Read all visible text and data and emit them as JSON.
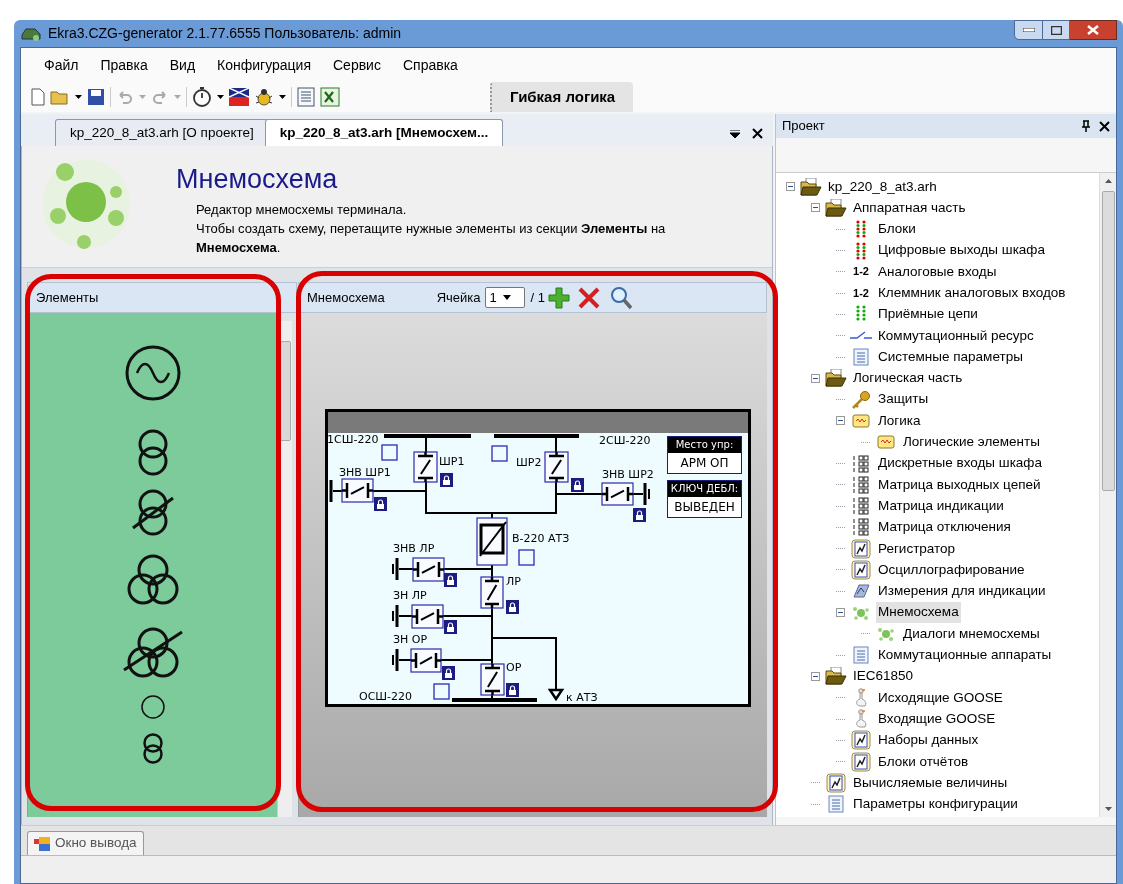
{
  "window": {
    "title": "Ekra3.CZG-generator 2.1.77.6555 Пользователь: admin"
  },
  "menu": [
    "Файл",
    "Правка",
    "Вид",
    "Конфигурация",
    "Сервис",
    "Справка"
  ],
  "toolbar": {
    "flex_button": "Гибкая логика"
  },
  "document_tabs": [
    {
      "label": "kp_220_8_at3.arh [О проекте]",
      "selected": false
    },
    {
      "label": "kp_220_8_at3.arh [Мнемосхем...",
      "selected": true
    }
  ],
  "header": {
    "title": "Мнемосхема",
    "description": [
      "Редактор мнемосхемы терминала.",
      "Чтобы создать схему, перетащите нужные элементы из секции **Элементы** на **Мнемосхема**."
    ]
  },
  "elements_panel": {
    "title": "Элементы"
  },
  "mnemo_panel": {
    "title": "Мнемосхема",
    "cell_label": "Ячейка",
    "cell_value": "1",
    "cell_total": "/ 1"
  },
  "diagram": {
    "labels": [
      "1СШ-220",
      "2СШ-220",
      "ШР1",
      "ШР2",
      "ЗНВ ШР1",
      "ЗНВ ШР2",
      "В-220 АТЗ",
      "ЗНВ ЛР",
      "ЛР",
      "ЗН ЛР",
      "ЗН ОР",
      "ОР",
      "ОСШ-220",
      "к АТЗ"
    ],
    "panels": [
      {
        "title": "Место упр:",
        "value": "АРМ ОП"
      },
      {
        "title": "КЛЮЧ ДЕБЛ:",
        "value": "ВЫВЕДЕН"
      }
    ]
  },
  "project_panel": {
    "title": "Проект",
    "tree": [
      {
        "label": "kp_220_8_at3.arh",
        "kind": "folder",
        "expanded": true,
        "selected": false,
        "children": [
          {
            "label": "Аппаратная часть",
            "kind": "folder",
            "expanded": true,
            "selected": false,
            "children": [
              {
                "label": "Блоки",
                "kind": "leds",
                "selected": false
              },
              {
                "label": "Цифровые выходы шкафа",
                "kind": "leds",
                "selected": false
              },
              {
                "label": "Аналоговые входы",
                "kind": "numbers",
                "icon_label": "1-2",
                "selected": false
              },
              {
                "label": "Клеммник аналоговых входов",
                "kind": "numbers",
                "icon_label": "1-2",
                "selected": false
              },
              {
                "label": "Приёмные цепи",
                "kind": "green_leds",
                "selected": false
              },
              {
                "label": "Коммутационный ресурс",
                "kind": "switch",
                "selected": false
              },
              {
                "label": "Системные параметры",
                "kind": "doc",
                "selected": false
              }
            ]
          },
          {
            "label": "Логическая часть",
            "kind": "folder",
            "expanded": true,
            "selected": false,
            "children": [
              {
                "label": "Защиты",
                "kind": "key",
                "selected": false
              },
              {
                "label": "Логика",
                "kind": "logic",
                "expanded": true,
                "selected": false,
                "children": [
                  {
                    "label": "Логические элементы",
                    "kind": "logic",
                    "selected": false
                  }
                ]
              },
              {
                "label": "Дискретные входы шкафа",
                "kind": "matrix",
                "selected": false
              },
              {
                "label": "Матрица выходных цепей",
                "kind": "matrix",
                "selected": false
              },
              {
                "label": "Матрица индикации",
                "kind": "matrix",
                "selected": false
              },
              {
                "label": "Матрица отключения",
                "kind": "matrix",
                "selected": false
              },
              {
                "label": "Регистратор",
                "kind": "chart",
                "selected": false
              },
              {
                "label": "Осциллографирование",
                "kind": "chart",
                "selected": false
              },
              {
                "label": "Измерения для индикации",
                "kind": "measure",
                "selected": false
              },
              {
                "label": "Мнемосхема",
                "kind": "scheme",
                "expanded": true,
                "selected": true,
                "children": [
                  {
                    "label": "Диалоги мнемосхемы",
                    "kind": "scheme",
                    "selected": false
                  }
                ]
              },
              {
                "label": "Коммутационные аппараты",
                "kind": "doc",
                "selected": false
              }
            ]
          },
          {
            "label": "IEC61850",
            "kind": "folder",
            "expanded": true,
            "selected": false,
            "children": [
              {
                "label": "Исходящие GOOSE",
                "kind": "goose",
                "selected": false
              },
              {
                "label": "Входящие GOOSE",
                "kind": "goose",
                "selected": false
              },
              {
                "label": "Наборы данных",
                "kind": "chart",
                "selected": false
              },
              {
                "label": "Блоки отчётов",
                "kind": "chart",
                "selected": false
              }
            ]
          },
          {
            "label": "Вычисляемые величины",
            "kind": "chart",
            "selected": false
          },
          {
            "label": "Параметры конфигурации",
            "kind": "doc",
            "selected": false
          }
        ]
      }
    ]
  },
  "output_tab": {
    "label": "Окно вывода"
  }
}
